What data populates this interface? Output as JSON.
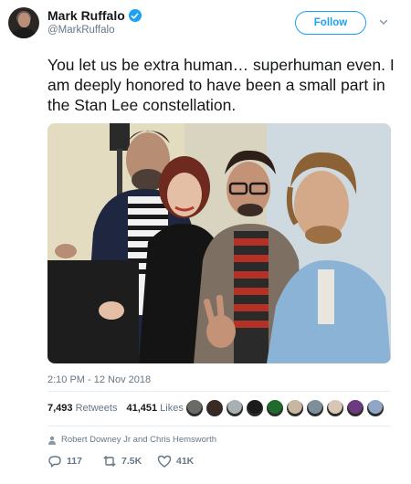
{
  "user": {
    "name": "Mark Ruffalo",
    "handle": "@MarkRuffalo"
  },
  "follow_label": "Follow",
  "tweet_text": "You let us be extra human… superhuman even. I am deeply honored to have been a small part in the Stan Lee constellation.",
  "timestamp": "2:10 PM - 12 Nov 2018",
  "stats": {
    "retweets_count": "7,493",
    "retweets_label": "Retweets",
    "likes_count": "41,451",
    "likes_label": "Likes"
  },
  "liker_colors": [
    "#6b6a66",
    "#3a2a24",
    "#a9b0b4",
    "#1b1b1b",
    "#1e6b2c",
    "#c6b6a2",
    "#7f8f9a",
    "#d8c7b5",
    "#6c3a7f",
    "#8fa6c7"
  ],
  "mentions": "Robert Downey Jr and Chris Hemsworth",
  "actions": {
    "reply_count": "117",
    "retweet_count": "7.5K",
    "like_count": "41K"
  },
  "colors": {
    "accent": "#1da1f2",
    "muted": "#657786",
    "text": "#14171a"
  }
}
